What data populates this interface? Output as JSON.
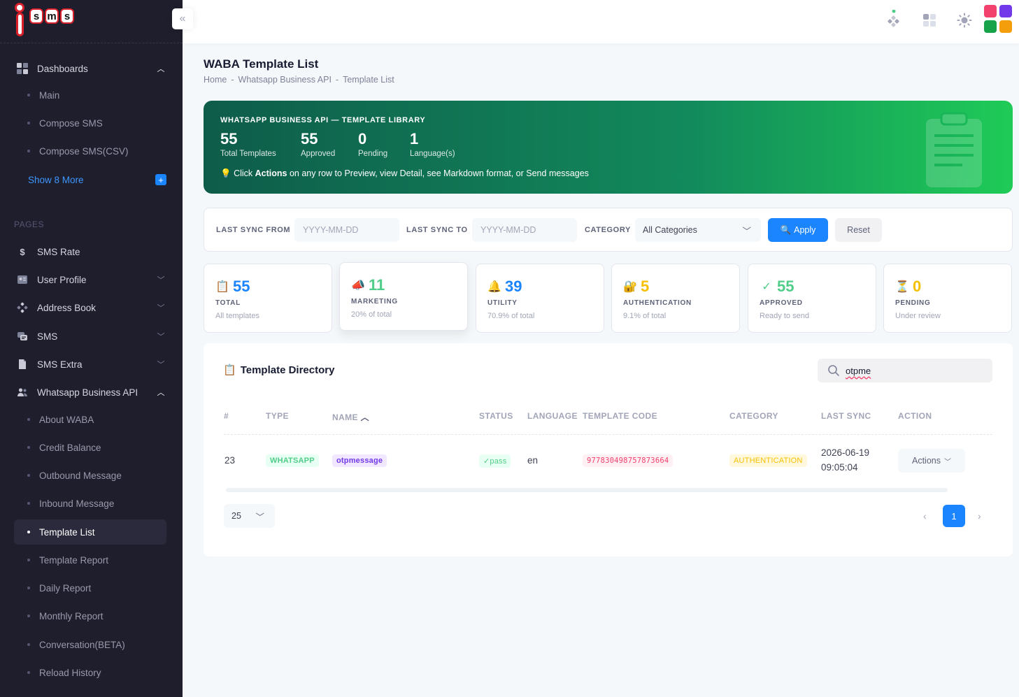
{
  "app": {
    "logo_letters": [
      "s",
      "m",
      "s"
    ]
  },
  "sidebar": {
    "dashboards": {
      "label": "Dashboards",
      "items": [
        "Main",
        "Compose SMS",
        "Compose SMS(CSV)"
      ],
      "show_more": "Show 8 More"
    },
    "pages_title": "PAGES",
    "sms_rate": "SMS Rate",
    "user_profile": "User Profile",
    "address_book": "Address Book",
    "sms": "SMS",
    "sms_extra": "SMS Extra",
    "waba": {
      "label": "Whatsapp Business API",
      "items": [
        "About WABA",
        "Credit Balance",
        "Outbound Message",
        "Inbound Message",
        "Template List",
        "Template Report",
        "Daily Report",
        "Monthly Report",
        "Conversation(BETA)",
        "Reload History"
      ]
    }
  },
  "page": {
    "title": "WABA Template List",
    "breadcrumb": [
      "Home",
      "-",
      "Whatsapp Business API",
      "-",
      "Template List"
    ]
  },
  "banner": {
    "title": "WHATSAPP BUSINESS API — TEMPLATE LIBRARY",
    "stats": [
      {
        "value": "55",
        "caption": "Total Templates"
      },
      {
        "value": "55",
        "caption": "Approved"
      },
      {
        "value": "0",
        "caption": "Pending"
      },
      {
        "value": "1",
        "caption": "Language(s)"
      }
    ],
    "hint_pre": "Click ",
    "hint_bold": "Actions",
    "hint_post": " on any row to Preview, view Detail, see Markdown format, or Send messages"
  },
  "filter": {
    "from_label": "LAST SYNC FROM",
    "from_placeholder": "YYYY-MM-DD",
    "to_label": "LAST SYNC TO",
    "to_placeholder": "YYYY-MM-DD",
    "category_label": "CATEGORY",
    "category_value": "All Categories",
    "apply": "Apply",
    "reset": "Reset"
  },
  "cards": [
    {
      "icon": "📋",
      "value": "55",
      "label": "TOTAL",
      "sub": "All templates",
      "color": "#1b84ff"
    },
    {
      "icon": "📣",
      "value": "11",
      "label": "MARKETING",
      "sub": "20% of total",
      "color": "#50cd89"
    },
    {
      "icon": "🔔",
      "value": "39",
      "label": "UTILITY",
      "sub": "70.9% of total",
      "color": "#1b84ff"
    },
    {
      "icon": "🔐",
      "value": "5",
      "label": "AUTHENTICATION",
      "sub": "9.1% of total",
      "color": "#f6c000"
    },
    {
      "icon": "✓",
      "value": "55",
      "label": "APPROVED",
      "sub": "Ready to send",
      "color": "#50cd89"
    },
    {
      "icon": "⏳",
      "value": "0",
      "label": "PENDING",
      "sub": "Under review",
      "color": "#f6c000"
    }
  ],
  "table": {
    "title": "Template Directory",
    "search_value": "otpme",
    "headers": [
      "#",
      "TYPE",
      "NAME",
      "STATUS",
      "LANGUAGE",
      "TEMPLATE CODE",
      "CATEGORY",
      "LAST SYNC",
      "ACTION"
    ],
    "rows": [
      {
        "no": "23",
        "type": "WHATSAPP",
        "name": "otpmessage",
        "status": "✓pass",
        "language": "en",
        "code": "977830498757873664",
        "category": "AUTHENTICATION",
        "sync_date": "2026-06-19",
        "sync_time": "09:05:04",
        "action": "Actions"
      }
    ],
    "page_size": "25",
    "current_page": "1"
  }
}
